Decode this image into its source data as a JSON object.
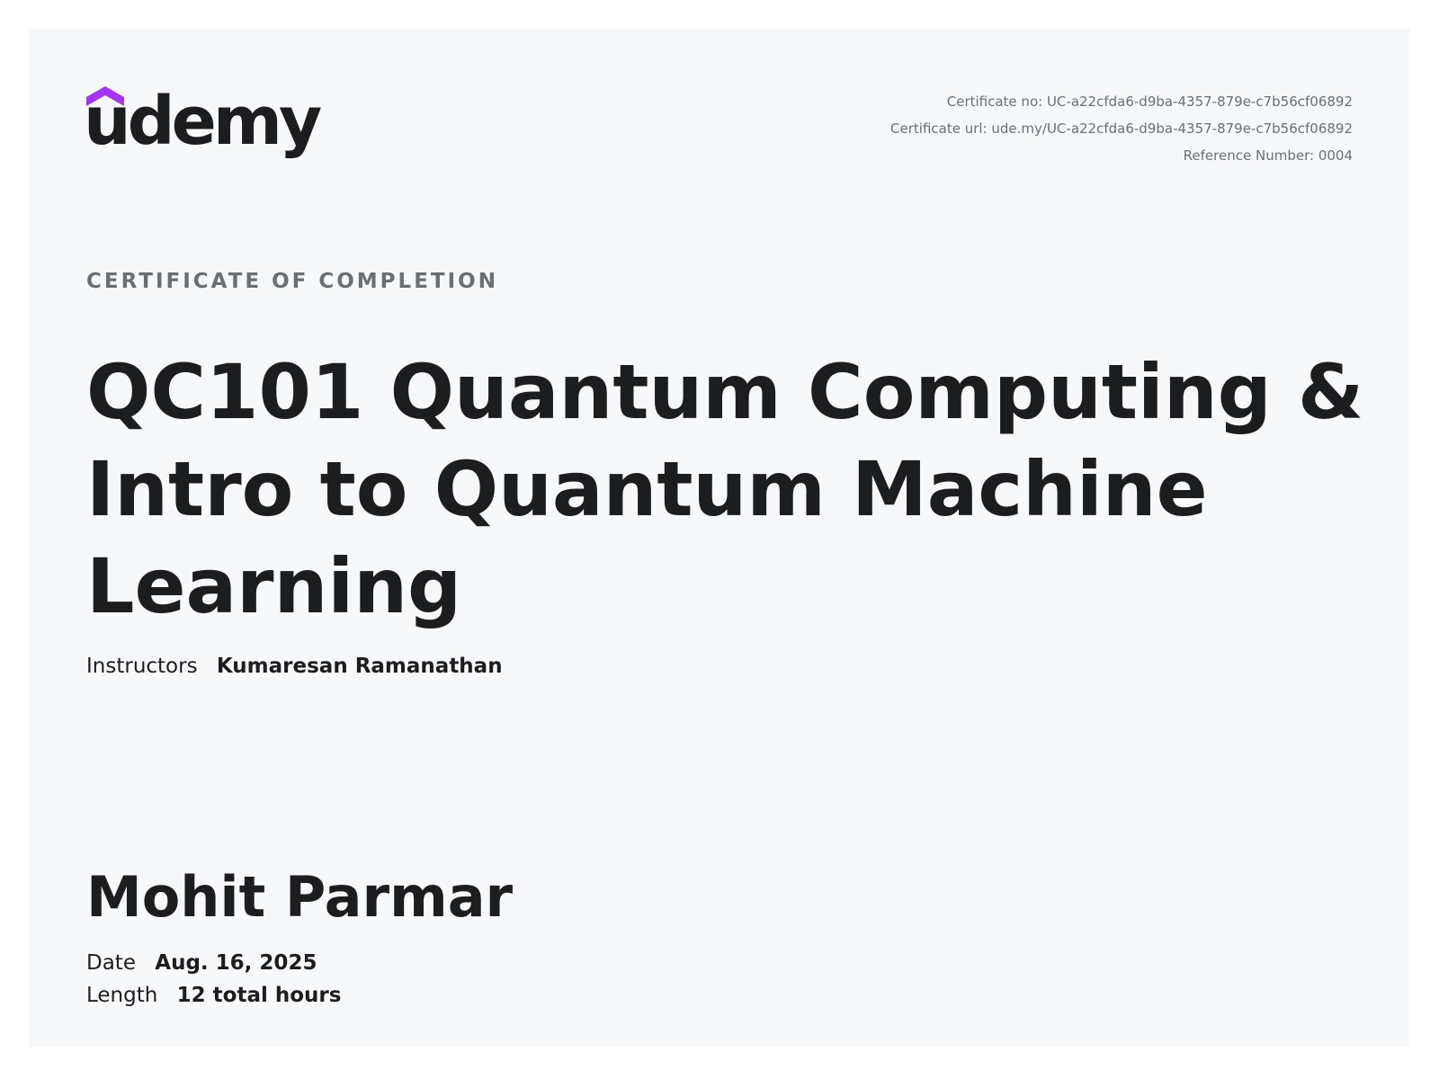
{
  "brand": {
    "name": "udemy",
    "accent_color": "#a435f0",
    "icon": "graduation-cap-icon"
  },
  "certificate": {
    "number_label": "Certificate no:",
    "number": "UC-a22cfda6-d9ba-4357-879e-c7b56cf06892",
    "url_label": "Certificate url:",
    "url": "ude.my/UC-a22cfda6-d9ba-4357-879e-c7b56cf06892",
    "reference_label": "Reference Number:",
    "reference": "0004"
  },
  "heading": "CERTIFICATE OF COMPLETION",
  "course": {
    "title": "QC101 Quantum Computing & Intro to Quantum Machine Learning"
  },
  "instructors": {
    "label": "Instructors",
    "names": "Kumaresan Ramanathan"
  },
  "student": {
    "name": "Mohit Parmar"
  },
  "details": {
    "date_label": "Date",
    "date": "Aug. 16, 2025",
    "length_label": "Length",
    "length": "12 total hours"
  }
}
